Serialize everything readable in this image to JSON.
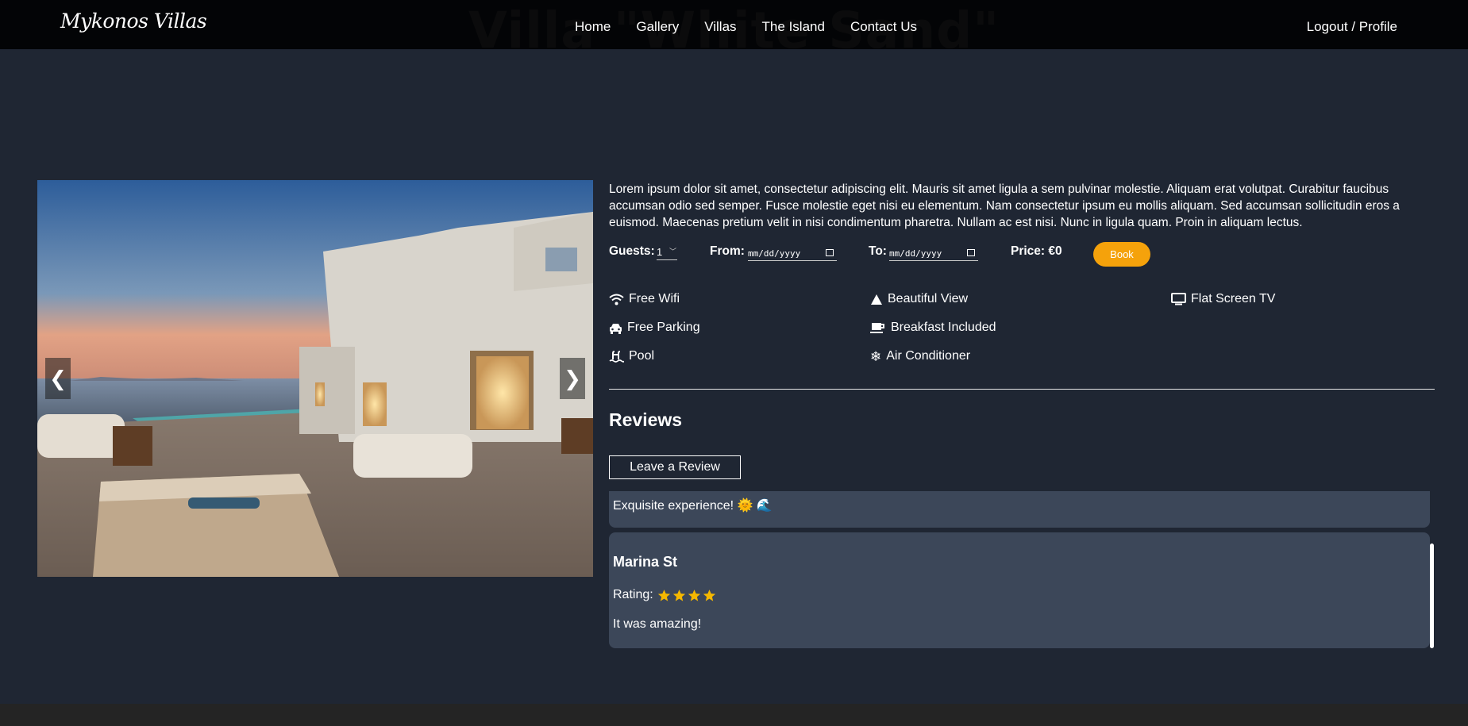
{
  "page": {
    "villa_title": "Villa \"White Sand\""
  },
  "nav": {
    "brand": "Mykonos Villas",
    "links": [
      "Home",
      "Gallery",
      "Villas",
      "The Island",
      "Contact Us"
    ],
    "account": "Logout / Profile"
  },
  "carousel": {
    "prev": "❮",
    "next": "❯"
  },
  "description": "Lorem ipsum dolor sit amet, consectetur adipiscing elit. Mauris sit amet ligula a sem pulvinar molestie. Aliquam erat volutpat. Curabitur faucibus accumsan odio sed semper. Fusce molestie eget nisi eu elementum. Nam consectetur ipsum eu mollis aliquam. Sed accumsan sollicitudin eros a euismod. Maecenas pretium velit in nisi condimentum pharetra. Nullam ac est nisi. Nunc in ligula quam. Proin in aliquam lectus.",
  "booking": {
    "guests_label": "Guests:",
    "guests_value": "1",
    "from_label": "From:",
    "from_placeholder": "mm/dd/yyyy",
    "to_label": "To:",
    "to_placeholder": "mm/dd/yyyy",
    "price_label": "Price: €0",
    "book_button": "Book"
  },
  "amenities": [
    {
      "label": "Free Wifi",
      "icon": "wifi-icon"
    },
    {
      "label": "Beautiful View",
      "icon": "mountain-icon"
    },
    {
      "label": "Flat Screen TV",
      "icon": "tv-icon"
    },
    {
      "label": "Free Parking",
      "icon": "car-icon"
    },
    {
      "label": "Breakfast Included",
      "icon": "coffee-icon"
    },
    {
      "label": "Pool",
      "icon": "pool-icon"
    },
    {
      "label": "Air Conditioner",
      "icon": "snowflake-icon"
    }
  ],
  "reviews": {
    "title": "Reviews",
    "leave_button": "Leave a Review",
    "items": [
      {
        "text": "Exquisite experience! 🌞 🌊"
      },
      {
        "author": "Marina St",
        "rating_label": "Rating:",
        "stars": 4,
        "text": "It was amazing!"
      }
    ]
  },
  "colors": {
    "accent": "#f5a20b",
    "background": "#1f2633",
    "card": "#3c4759",
    "star": "#f5b800"
  }
}
